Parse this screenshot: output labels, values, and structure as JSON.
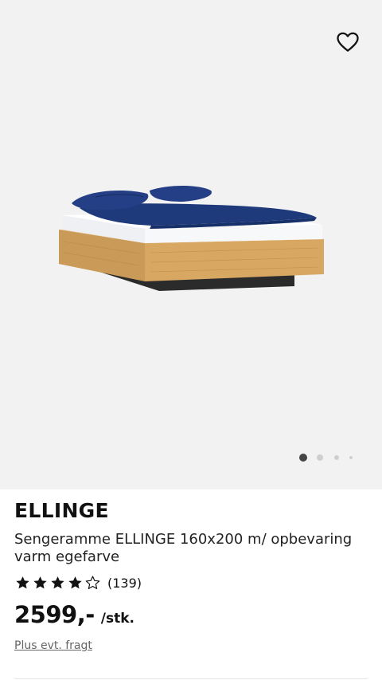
{
  "product": {
    "brand": "ELLINGE",
    "description": "Sengeramme ELLINGE 160x200 m/ opbevaring varm egefarve",
    "rating_stars": 4,
    "rating_max": 5,
    "review_count": "(139)",
    "price": "2599,-",
    "price_unit": "/stk.",
    "freight_link": "Plus evt. fragt"
  },
  "gallery": {
    "image": "bed-frame-photo",
    "slide_count": 4,
    "active_slide": 1
  },
  "icons": {
    "wishlist": "heart-outline-icon",
    "star_full": "star-filled-icon",
    "star_empty": "star-outline-icon"
  },
  "colors": {
    "hero_background": "#f2f2f2",
    "oak": "#d8a863",
    "bedding": "#1f3a7a",
    "active_dot": "#444444"
  }
}
